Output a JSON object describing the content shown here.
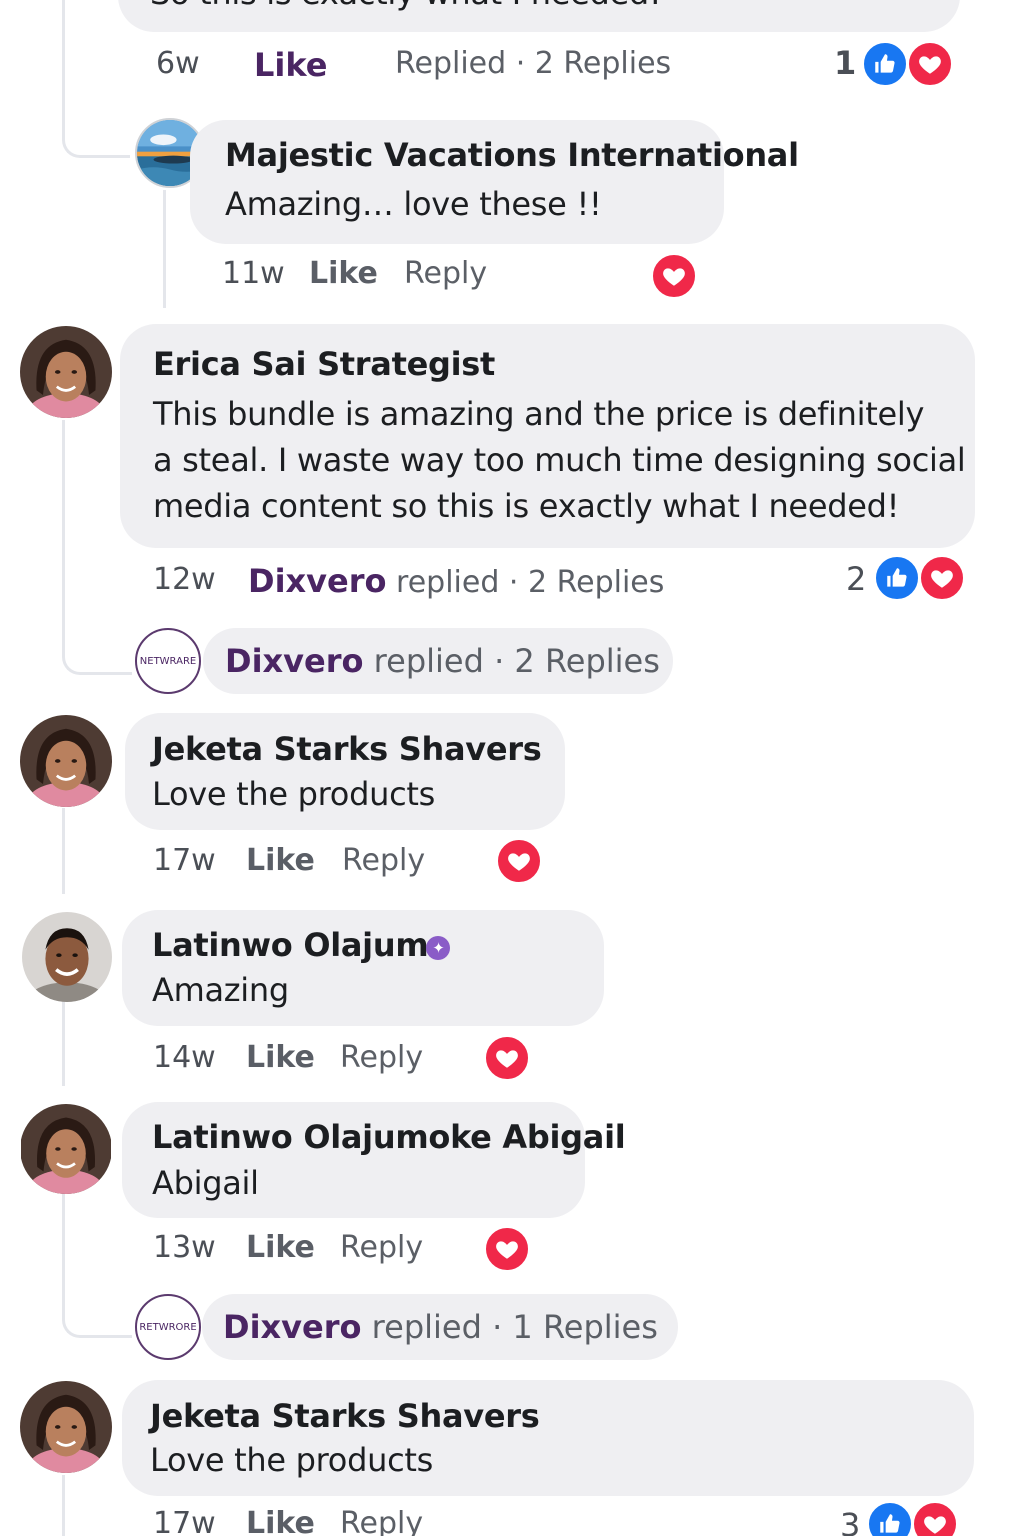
{
  "top_comment": {
    "text_partial": "So this is exactly what I needed!",
    "time": "6w",
    "like": "Like",
    "replied": "Replied · 2 Replies",
    "reaction_count": "1"
  },
  "reply_majestic": {
    "name": "Majestic Vacations International",
    "text": "Amazing… love these !!",
    "time": "11w",
    "like": "Like",
    "reply": "Reply"
  },
  "comment_erica": {
    "name": "Erica Sai Strategist",
    "lines": [
      "This bundle is amazing and the price is definitely",
      "a steal. I waste way too much time designing social",
      "media content so this is exactly what I needed!"
    ],
    "time": "12w",
    "replier": "Dixvero",
    "replied": "replied · 2 Replies",
    "reaction_count": "2"
  },
  "thread_dixvero_1": {
    "avatar_text": "NETWRARE",
    "replier": "Dixvero",
    "replied": "replied · 2 Replies"
  },
  "comment_jeketa_1": {
    "name": "Jeketa Starks Shavers",
    "text": "Love the products",
    "time": "17w",
    "like": "Like",
    "reply": "Reply"
  },
  "comment_latinwo_1": {
    "name": "Latinwo Olajum",
    "text": "Amazing",
    "time": "14w",
    "like": "Like",
    "reply": "Reply"
  },
  "comment_latinwo_2": {
    "name": "Latinwo Olajumoke Abigail",
    "text": "Abigail",
    "time": "13w",
    "like": "Like",
    "reply": "Reply"
  },
  "thread_dixvero_2": {
    "avatar_text": "RETWRORE",
    "replier": "Dixvero",
    "replied": "replied · 1 Replies"
  },
  "comment_jeketa_2": {
    "name": "Jeketa Starks Shavers",
    "text": "Love the products",
    "time": "17w",
    "like": "Like",
    "reply": "Reply",
    "reaction_count": "3"
  },
  "icons": {
    "like": "thumbs-up-icon",
    "heart": "heart-icon",
    "verified": "verified-badge-icon"
  },
  "colors": {
    "like_blue": "#1877f2",
    "heart_red": "#f02849",
    "brand_purple": "#4a2563",
    "bubble": "#efeff2"
  }
}
